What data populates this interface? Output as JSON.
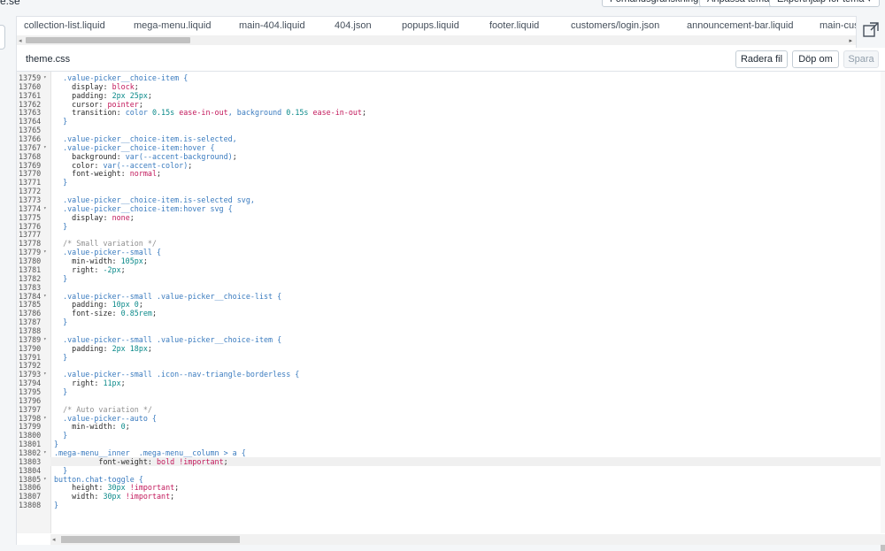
{
  "topbar": {
    "site_name": "e.se",
    "preview_label": "Förhandsgranskning",
    "customize_label": "Anpassa tema",
    "expert_label": "Experthjälp för tema ▾"
  },
  "tabs": [
    {
      "label": "collection-list.liquid"
    },
    {
      "label": "mega-menu.liquid"
    },
    {
      "label": "main-404.liquid"
    },
    {
      "label": "404.json"
    },
    {
      "label": "popups.liquid"
    },
    {
      "label": "footer.liquid"
    },
    {
      "label": "customers/login.json"
    },
    {
      "label": "announcement-bar.liquid"
    },
    {
      "label": "main-cust"
    }
  ],
  "editor": {
    "file_name": "theme.css",
    "delete_label": "Radera fil",
    "rename_label": "Döp om",
    "save_label": "Spara"
  },
  "icons": {
    "expand": "expand-icon",
    "fold": "fold-arrow-icon",
    "scroll_left": "arrow-left-icon",
    "scroll_right": "arrow-right-icon"
  },
  "active_line": "13803",
  "code_lines": [
    {
      "n": "13759",
      "fold": true,
      "t": "  .value-picker__choice-item {"
    },
    {
      "n": "13760",
      "fold": false,
      "t": "    display: block;"
    },
    {
      "n": "13761",
      "fold": false,
      "t": "    padding: 2px 25px;"
    },
    {
      "n": "13762",
      "fold": false,
      "t": "    cursor: pointer;"
    },
    {
      "n": "13763",
      "fold": false,
      "t": "    transition: color 0.15s ease-in-out, background 0.15s ease-in-out;"
    },
    {
      "n": "13764",
      "fold": false,
      "t": "  }"
    },
    {
      "n": "13765",
      "fold": false,
      "t": ""
    },
    {
      "n": "13766",
      "fold": false,
      "t": "  .value-picker__choice-item.is-selected,"
    },
    {
      "n": "13767",
      "fold": true,
      "t": "  .value-picker__choice-item:hover {"
    },
    {
      "n": "13768",
      "fold": false,
      "t": "    background: var(--accent-background);"
    },
    {
      "n": "13769",
      "fold": false,
      "t": "    color: var(--accent-color);"
    },
    {
      "n": "13770",
      "fold": false,
      "t": "    font-weight: normal;"
    },
    {
      "n": "13771",
      "fold": false,
      "t": "  }"
    },
    {
      "n": "13772",
      "fold": false,
      "t": ""
    },
    {
      "n": "13773",
      "fold": false,
      "t": "  .value-picker__choice-item.is-selected svg,"
    },
    {
      "n": "13774",
      "fold": true,
      "t": "  .value-picker__choice-item:hover svg {"
    },
    {
      "n": "13775",
      "fold": false,
      "t": "    display: none;"
    },
    {
      "n": "13776",
      "fold": false,
      "t": "  }"
    },
    {
      "n": "13777",
      "fold": false,
      "t": ""
    },
    {
      "n": "13778",
      "fold": false,
      "t": "  /* Small variation */"
    },
    {
      "n": "13779",
      "fold": true,
      "t": "  .value-picker--small {"
    },
    {
      "n": "13780",
      "fold": false,
      "t": "    min-width: 105px;"
    },
    {
      "n": "13781",
      "fold": false,
      "t": "    right: -2px;"
    },
    {
      "n": "13782",
      "fold": false,
      "t": "  }"
    },
    {
      "n": "13783",
      "fold": false,
      "t": ""
    },
    {
      "n": "13784",
      "fold": true,
      "t": "  .value-picker--small .value-picker__choice-list {"
    },
    {
      "n": "13785",
      "fold": false,
      "t": "    padding: 10px 0;"
    },
    {
      "n": "13786",
      "fold": false,
      "t": "    font-size: 0.85rem;"
    },
    {
      "n": "13787",
      "fold": false,
      "t": "  }"
    },
    {
      "n": "13788",
      "fold": false,
      "t": ""
    },
    {
      "n": "13789",
      "fold": true,
      "t": "  .value-picker--small .value-picker__choice-item {"
    },
    {
      "n": "13790",
      "fold": false,
      "t": "    padding: 2px 18px;"
    },
    {
      "n": "13791",
      "fold": false,
      "t": "  }"
    },
    {
      "n": "13792",
      "fold": false,
      "t": ""
    },
    {
      "n": "13793",
      "fold": true,
      "t": "  .value-picker--small .icon--nav-triangle-borderless {"
    },
    {
      "n": "13794",
      "fold": false,
      "t": "    right: 11px;"
    },
    {
      "n": "13795",
      "fold": false,
      "t": "  }"
    },
    {
      "n": "13796",
      "fold": false,
      "t": ""
    },
    {
      "n": "13797",
      "fold": false,
      "t": "  /* Auto variation */"
    },
    {
      "n": "13798",
      "fold": true,
      "t": "  .value-picker--auto {"
    },
    {
      "n": "13799",
      "fold": false,
      "t": "    min-width: 0;"
    },
    {
      "n": "13800",
      "fold": false,
      "t": "  }"
    },
    {
      "n": "13801",
      "fold": false,
      "t": "}"
    },
    {
      "n": "13802",
      "fold": true,
      "t": ".mega-menu__inner  .mega-menu__column > a {"
    },
    {
      "n": "13803",
      "fold": false,
      "t": "          font-weight: bold !important;"
    },
    {
      "n": "13804",
      "fold": false,
      "t": "  }"
    },
    {
      "n": "13805",
      "fold": true,
      "t": "button.chat-toggle {"
    },
    {
      "n": "13806",
      "fold": false,
      "t": "    height: 30px !important;"
    },
    {
      "n": "13807",
      "fold": false,
      "t": "    width: 30px !important;"
    },
    {
      "n": "13808",
      "fold": false,
      "t": "}"
    }
  ]
}
